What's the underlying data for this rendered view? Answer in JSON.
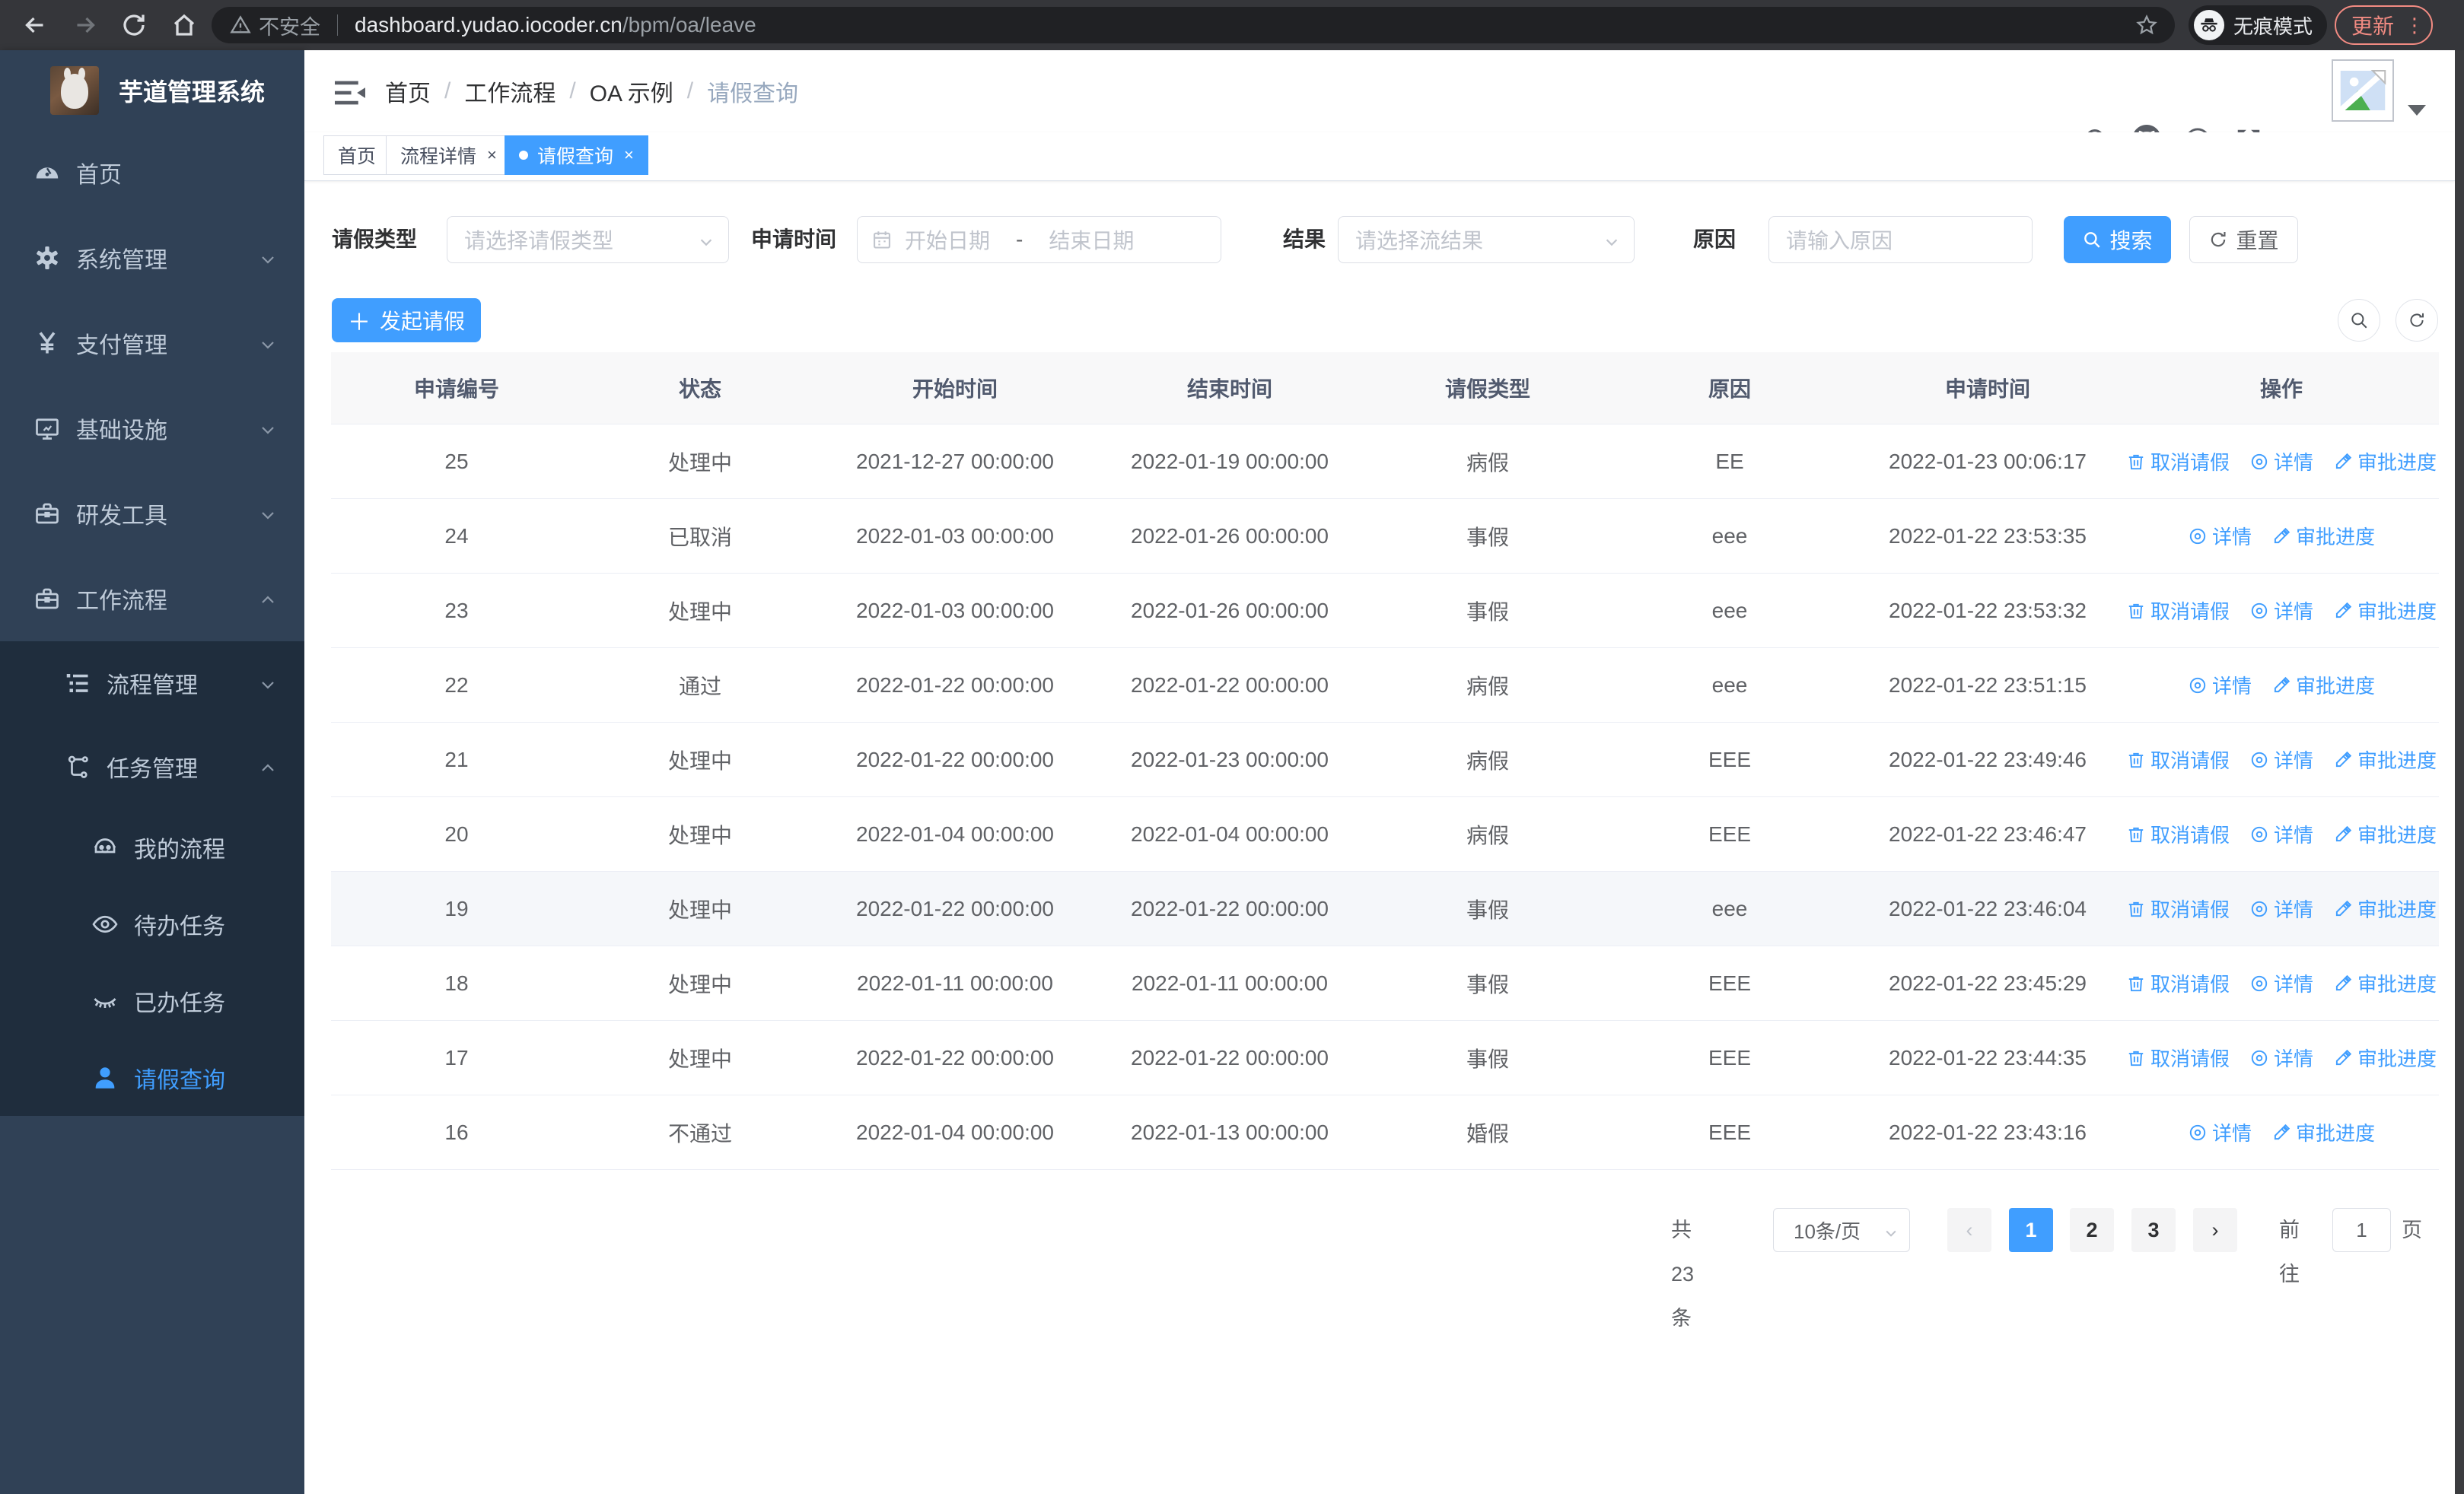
{
  "colors": {
    "accent": "#409eff",
    "sidebar_bg": "#304156",
    "submenu_bg": "#1f2d3d",
    "active_tab": "#409eff"
  },
  "browser": {
    "security_label": "不安全",
    "url_host": "dashboard.yudao.iocoder.cn",
    "url_path": "/bpm/oa/leave",
    "incognito_label": "无痕模式",
    "update_label": "更新"
  },
  "sidebar": {
    "app_title": "芋道管理系统",
    "menu": [
      {
        "label": "首页",
        "icon": "dashboard-icon",
        "level": 1,
        "arrow": null,
        "sub": false,
        "active": false
      },
      {
        "label": "系统管理",
        "icon": "gear-icon",
        "level": 1,
        "arrow": "down",
        "sub": false,
        "active": false
      },
      {
        "label": "支付管理",
        "icon": "yen-icon",
        "level": 1,
        "arrow": "down",
        "sub": false,
        "active": false
      },
      {
        "label": "基础设施",
        "icon": "monitor-icon",
        "level": 1,
        "arrow": "down",
        "sub": false,
        "active": false
      },
      {
        "label": "研发工具",
        "icon": "toolbox-icon",
        "level": 1,
        "arrow": "down",
        "sub": false,
        "active": false
      },
      {
        "label": "工作流程",
        "icon": "briefcase-icon",
        "level": 1,
        "arrow": "up",
        "sub": false,
        "active": false
      },
      {
        "label": "流程管理",
        "icon": "list-tree-icon",
        "level": 2,
        "arrow": "down",
        "sub": true,
        "active": false
      },
      {
        "label": "任务管理",
        "icon": "org-icon",
        "level": 2,
        "arrow": "up",
        "sub": true,
        "active": false
      },
      {
        "label": "我的流程",
        "icon": "robot-icon",
        "level": 3,
        "arrow": null,
        "sub": true,
        "active": false
      },
      {
        "label": "待办任务",
        "icon": "eye-open-icon",
        "level": 3,
        "arrow": null,
        "sub": true,
        "active": false
      },
      {
        "label": "已办任务",
        "icon": "eye-closed-icon",
        "level": 3,
        "arrow": null,
        "sub": true,
        "active": false
      },
      {
        "label": "请假查询",
        "icon": "user-icon",
        "level": 3,
        "arrow": null,
        "sub": true,
        "active": true
      }
    ]
  },
  "header": {
    "breadcrumb": [
      "首页",
      "工作流程",
      "OA 示例",
      "请假查询"
    ]
  },
  "tabs": [
    {
      "label": "首页",
      "closable": false,
      "active": false
    },
    {
      "label": "流程详情",
      "closable": true,
      "active": false
    },
    {
      "label": "请假查询",
      "closable": true,
      "active": true
    }
  ],
  "filters": {
    "leave_type_label": "请假类型",
    "leave_type_placeholder": "请选择请假类型",
    "apply_time_label": "申请时间",
    "start_date_placeholder": "开始日期",
    "date_separator": "-",
    "end_date_placeholder": "结束日期",
    "result_label": "结果",
    "result_placeholder": "请选择流结果",
    "reason_label": "原因",
    "reason_placeholder": "请输入原因",
    "search_button": "搜索",
    "reset_button": "重置"
  },
  "toolbar": {
    "create_button": "发起请假"
  },
  "table": {
    "columns": [
      "申请编号",
      "状态",
      "开始时间",
      "结束时间",
      "请假类型",
      "原因",
      "申请时间",
      "操作"
    ],
    "action_labels": {
      "cancel": "取消请假",
      "detail": "详情",
      "progress": "审批进度"
    },
    "rows": [
      {
        "id": "25",
        "status": "处理中",
        "start": "2021-12-27 00:00:00",
        "end": "2022-01-19 00:00:00",
        "type": "病假",
        "reason": "EE",
        "apply_time": "2022-01-23 00:06:17",
        "actions": [
          "cancel",
          "detail",
          "progress"
        ],
        "highlighted": false
      },
      {
        "id": "24",
        "status": "已取消",
        "start": "2022-01-03 00:00:00",
        "end": "2022-01-26 00:00:00",
        "type": "事假",
        "reason": "eee",
        "apply_time": "2022-01-22 23:53:35",
        "actions": [
          "detail",
          "progress"
        ],
        "highlighted": false
      },
      {
        "id": "23",
        "status": "处理中",
        "start": "2022-01-03 00:00:00",
        "end": "2022-01-26 00:00:00",
        "type": "事假",
        "reason": "eee",
        "apply_time": "2022-01-22 23:53:32",
        "actions": [
          "cancel",
          "detail",
          "progress"
        ],
        "highlighted": false
      },
      {
        "id": "22",
        "status": "通过",
        "start": "2022-01-22 00:00:00",
        "end": "2022-01-22 00:00:00",
        "type": "病假",
        "reason": "eee",
        "apply_time": "2022-01-22 23:51:15",
        "actions": [
          "detail",
          "progress"
        ],
        "highlighted": false
      },
      {
        "id": "21",
        "status": "处理中",
        "start": "2022-01-22 00:00:00",
        "end": "2022-01-23 00:00:00",
        "type": "病假",
        "reason": "EEE",
        "apply_time": "2022-01-22 23:49:46",
        "actions": [
          "cancel",
          "detail",
          "progress"
        ],
        "highlighted": false
      },
      {
        "id": "20",
        "status": "处理中",
        "start": "2022-01-04 00:00:00",
        "end": "2022-01-04 00:00:00",
        "type": "病假",
        "reason": "EEE",
        "apply_time": "2022-01-22 23:46:47",
        "actions": [
          "cancel",
          "detail",
          "progress"
        ],
        "highlighted": false
      },
      {
        "id": "19",
        "status": "处理中",
        "start": "2022-01-22 00:00:00",
        "end": "2022-01-22 00:00:00",
        "type": "事假",
        "reason": "eee",
        "apply_time": "2022-01-22 23:46:04",
        "actions": [
          "cancel",
          "detail",
          "progress"
        ],
        "highlighted": true
      },
      {
        "id": "18",
        "status": "处理中",
        "start": "2022-01-11 00:00:00",
        "end": "2022-01-11 00:00:00",
        "type": "事假",
        "reason": "EEE",
        "apply_time": "2022-01-22 23:45:29",
        "actions": [
          "cancel",
          "detail",
          "progress"
        ],
        "highlighted": false
      },
      {
        "id": "17",
        "status": "处理中",
        "start": "2022-01-22 00:00:00",
        "end": "2022-01-22 00:00:00",
        "type": "事假",
        "reason": "EEE",
        "apply_time": "2022-01-22 23:44:35",
        "actions": [
          "cancel",
          "detail",
          "progress"
        ],
        "highlighted": false
      },
      {
        "id": "16",
        "status": "不通过",
        "start": "2022-01-04 00:00:00",
        "end": "2022-01-13 00:00:00",
        "type": "婚假",
        "reason": "EEE",
        "apply_time": "2022-01-22 23:43:16",
        "actions": [
          "detail",
          "progress"
        ],
        "highlighted": false
      }
    ]
  },
  "pagination": {
    "total_label": "共 23 条",
    "page_size": "10条/页",
    "prev_symbol": "‹",
    "next_symbol": "›",
    "pages": [
      "1",
      "2",
      "3"
    ],
    "active_page": "1",
    "goto_label": "前往",
    "goto_value": "1",
    "page_unit": "页"
  }
}
